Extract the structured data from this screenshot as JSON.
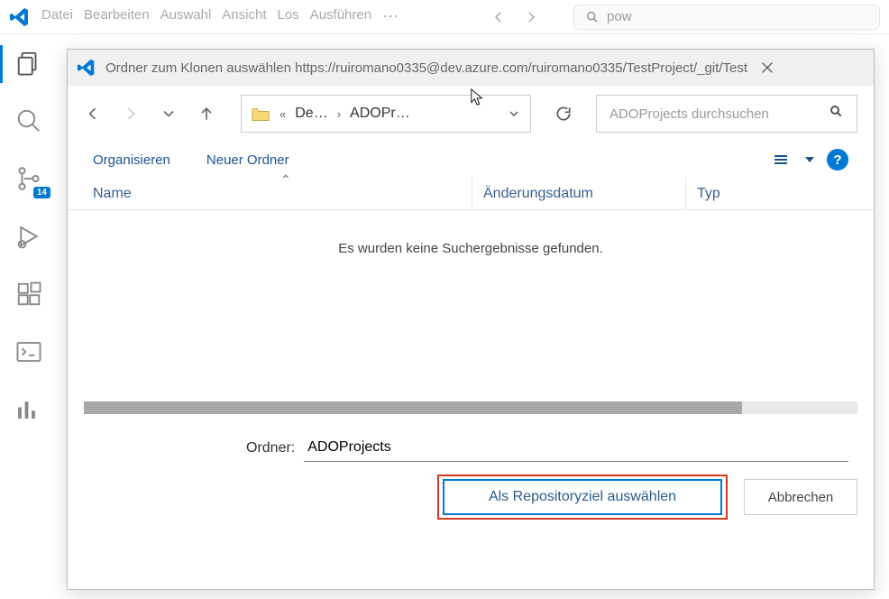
{
  "menu": {
    "file": "Datei",
    "edit": "Bearbeiten",
    "selection": "Auswahl",
    "view": "Ansicht",
    "go": "Los",
    "run": "Ausführen"
  },
  "topSearch": {
    "placeholder": "pow"
  },
  "activity": {
    "scmBadge": "14"
  },
  "dialog": {
    "title": "Ordner zum Klonen auswählen https://ruiromano0335@dev.azure.com/ruiromano0335/TestProject/_git/Test",
    "crumb1": "De…",
    "crumb2": "ADOPr…",
    "searchPlaceholder": "ADOProjects durchsuchen",
    "organize": "Organisieren",
    "newFolder": "Neuer Ordner",
    "colName": "Name",
    "colDate": "Änderungsdatum",
    "colType": "Typ",
    "emptyMsg": "Es wurden keine Suchergebnisse gefunden.",
    "folderLabel": "Ordner:",
    "folderValue": "ADOProjects",
    "primaryLabel": "Als Repositoryziel auswählen",
    "cancelLabel": "Abbrechen",
    "helpChar": "?",
    "breadcrumbDoubleLeft": "«",
    "crumbSeparator": "›"
  }
}
